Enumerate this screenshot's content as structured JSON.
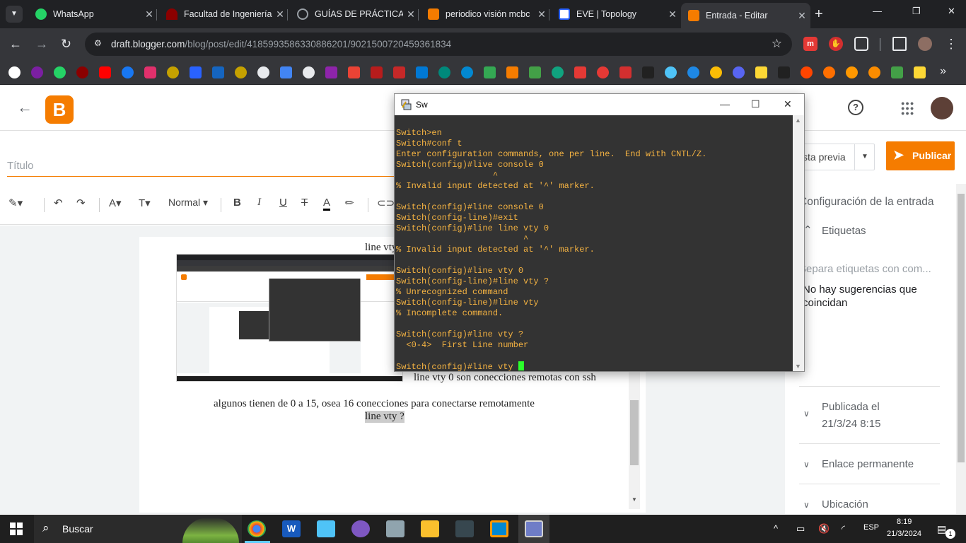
{
  "tabs": [
    {
      "title": "WhatsApp",
      "color": "#25d366",
      "icon": "whatsapp-icon"
    },
    {
      "title": "Facultad de Ingeniería",
      "color": "#8b0000",
      "icon": "university-icon"
    },
    {
      "title": "GUÍAS DE PRÁCTICAS",
      "color": "#9aa0a6",
      "icon": "globe-icon"
    },
    {
      "title": "periodico visión mcbc",
      "color": "#f57c00",
      "icon": "blogger-icon"
    },
    {
      "title": "EVE | Topology",
      "color": "#2962ff",
      "icon": "eve-icon"
    },
    {
      "title": "Entrada - Editar",
      "color": "#f57c00",
      "icon": "blogger-icon"
    }
  ],
  "address": {
    "domain": "draft.blogger.com",
    "path": "/blog/post/edit/4185993586330886201/9021500720459361834"
  },
  "editor": {
    "title_placeholder": "Título",
    "format_label": "Normal",
    "text_top": "line vty",
    "text_side": "line vty 0 son conecciones remotas con ssh",
    "text_middle": "algunos tienen de 0 a 15, osea 16 conecciones para conectarse remotamente",
    "text_selected": "line vty ?"
  },
  "sidebar": {
    "preview_label": "sta previa",
    "publish_label": "Publicar",
    "settings_title": "Configuración de la entrada",
    "labels_title": "Etiquetas",
    "labels_placeholder": "Separa etiquetas con com...",
    "no_suggestions": "No hay sugerencias que coincidan",
    "published_label": "Publicada el",
    "published_date": "21/3/24 8:15",
    "permalink_label": "Enlace permanente",
    "location_label": "Ubicación"
  },
  "terminal": {
    "title": "Sw",
    "lines": [
      "Switch>en",
      "Switch#conf t",
      "Enter configuration commands, one per line.  End with CNTL/Z.",
      "Switch(config)#live console 0",
      "                   ^",
      "% Invalid input detected at '^' marker.",
      "",
      "Switch(config)#line console 0",
      "Switch(config-line)#exit",
      "Switch(config)#line line vty 0",
      "                         ^",
      "% Invalid input detected at '^' marker.",
      "",
      "Switch(config)#line vty 0",
      "Switch(config-line)#line vty ?",
      "% Unrecognized command",
      "Switch(config-line)#line vty",
      "% Incomplete command.",
      "",
      "Switch(config)#line vty ?",
      "  <0-4>  First Line number",
      "",
      "Switch(config)#line vty "
    ]
  },
  "taskbar": {
    "search_label": "Buscar",
    "language": "ESP",
    "time": "8:19",
    "date": "21/3/2024",
    "notifications": "1"
  }
}
